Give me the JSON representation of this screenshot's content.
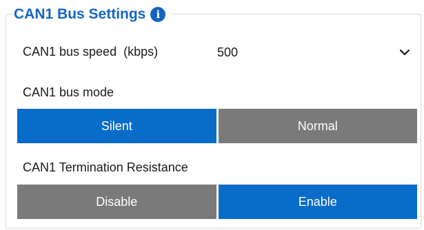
{
  "group": {
    "title": "CAN1 Bus Settings",
    "info_icon": "info-icon",
    "info_glyph": "i"
  },
  "speed": {
    "label": "CAN1 bus speed  (kbps)",
    "selected": "500",
    "icon": "chevron-down-icon"
  },
  "mode": {
    "label": "CAN1 bus mode",
    "options": [
      {
        "label": "Silent",
        "active": true
      },
      {
        "label": "Normal",
        "active": false
      }
    ]
  },
  "termination": {
    "label": "CAN1 Termination Resistance",
    "options": [
      {
        "label": "Disable",
        "active": false
      },
      {
        "label": "Enable",
        "active": true
      }
    ]
  },
  "colors": {
    "accent": "#0a6cc9",
    "title": "#1565c0",
    "inactive": "#7a7a7a"
  }
}
